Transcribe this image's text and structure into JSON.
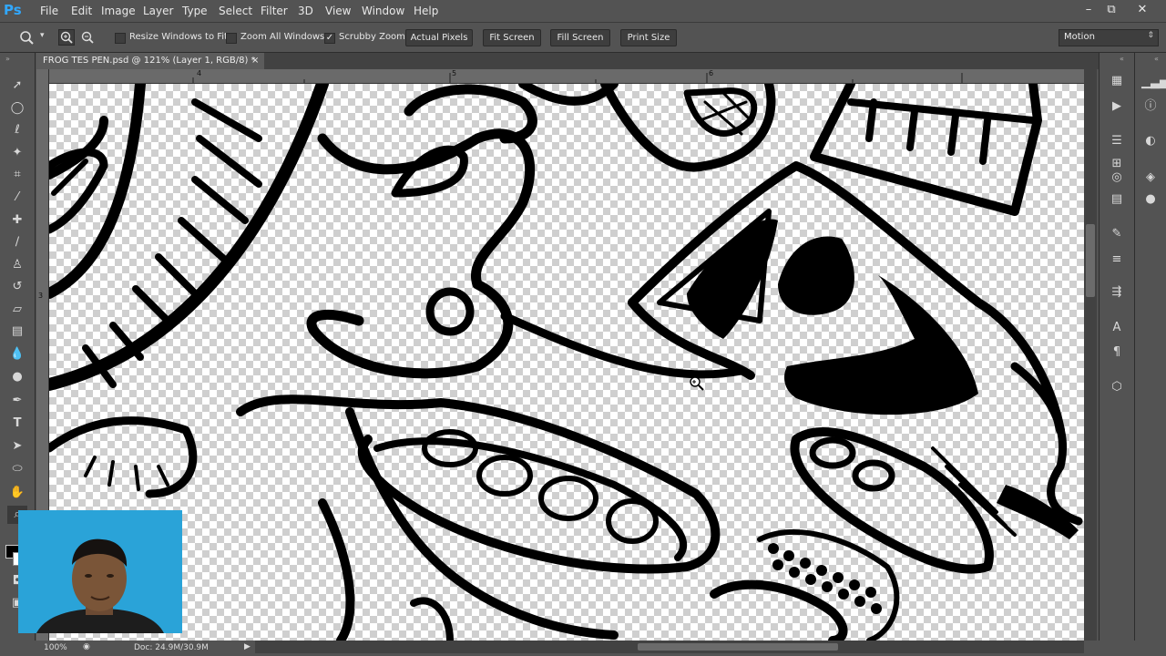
{
  "app": {
    "logo": "Ps"
  },
  "menu": [
    "File",
    "Edit",
    "Image",
    "Layer",
    "Type",
    "Select",
    "Filter",
    "3D",
    "View",
    "Window",
    "Help"
  ],
  "window_controls": [
    "–",
    "⧉",
    "✕"
  ],
  "options": {
    "checkboxes": [
      {
        "label": "Resize Windows to Fit",
        "checked": false
      },
      {
        "label": "Zoom All Windows",
        "checked": false
      },
      {
        "label": "Scrubby Zoom",
        "checked": true
      }
    ],
    "buttons": [
      "Actual Pixels",
      "Fit Screen",
      "Fill Screen",
      "Print Size"
    ],
    "workspace": "Motion"
  },
  "document": {
    "tab_title": "FROG TES PEN.psd @ 121% (Layer 1, RGB/8) *",
    "close": "×"
  },
  "ruler": {
    "top_ticks": [
      "4",
      "5",
      "6"
    ],
    "left_ticks": [
      "3"
    ]
  },
  "status": {
    "zoom": "100%",
    "doc": "Doc: 24.9M/30.9M"
  },
  "colors": {
    "ps_blue": "#31a8ff",
    "ui_bg": "#535353",
    "panel_dark": "#424242",
    "webcam_bg": "#2aa3d8"
  }
}
